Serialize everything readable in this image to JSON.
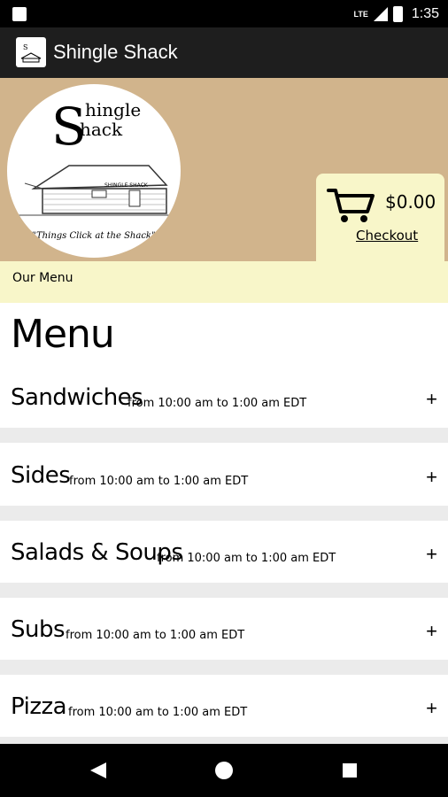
{
  "status_bar": {
    "network": "LTE",
    "time": "1:35"
  },
  "app_bar": {
    "title": "Shingle Shack"
  },
  "hero": {
    "logo_text": "Shingle Shack",
    "logo_tagline": "\"Things Click at the Shack\"",
    "logo_sign": "SHINGLE SHACK"
  },
  "cart": {
    "amount": "$0.00",
    "checkout_label": "Checkout"
  },
  "breadcrumb": "Our Menu",
  "menu": {
    "title": "Menu",
    "sections": [
      {
        "name": "Sandwiches",
        "hours": "from 10:00 am to 1:00 am EDT"
      },
      {
        "name": "Sides",
        "hours": "from 10:00 am to 1:00 am EDT"
      },
      {
        "name": "Salads & Soups",
        "hours": "from 10:00 am to 1:00 am EDT"
      },
      {
        "name": "Subs",
        "hours": "from 10:00 am to 1:00 am EDT"
      },
      {
        "name": "Pizza",
        "hours": "from 10:00 am to 1:00 am EDT"
      }
    ],
    "expand_symbol": "+"
  },
  "icons": {
    "status_left": "sim-card-icon",
    "signal": "signal-icon",
    "battery": "battery-icon",
    "cart": "shopping-cart-icon",
    "back": "back-triangle-icon",
    "home": "home-circle-icon",
    "recents": "recents-square-icon"
  },
  "colors": {
    "hero_bg": "#d1b48c",
    "cream": "#f8f6c9",
    "app_bar": "#1e1e1e"
  }
}
